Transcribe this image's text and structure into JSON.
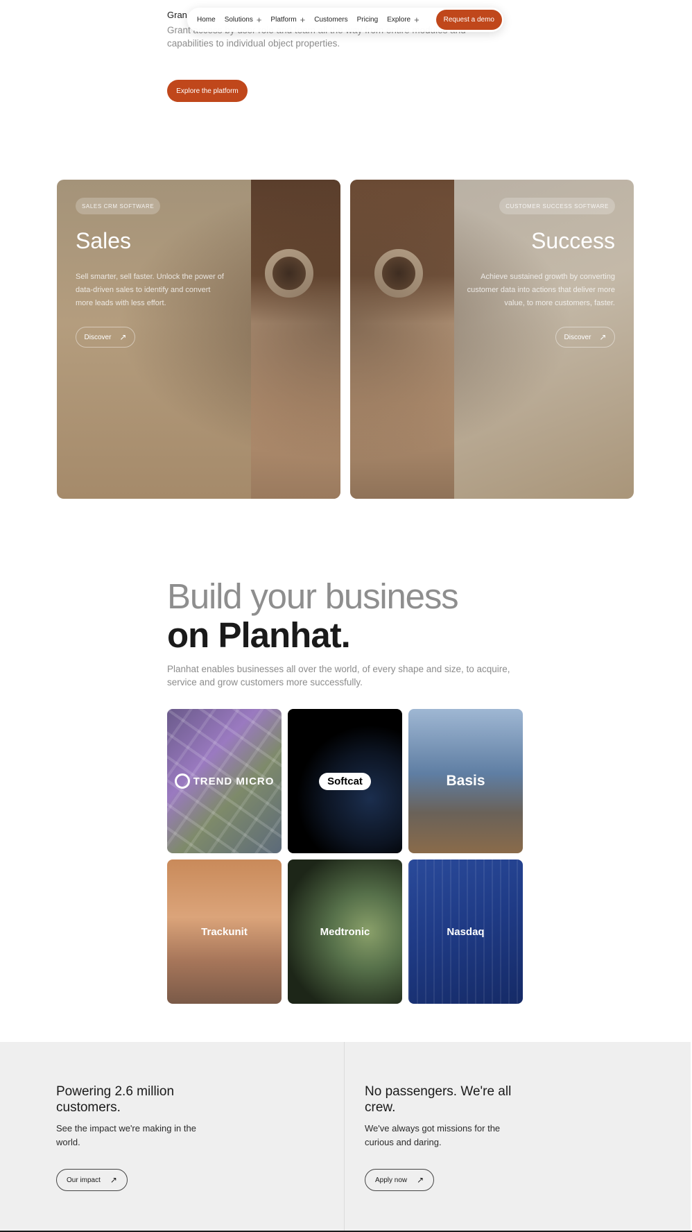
{
  "intro": {
    "heading": "Gran",
    "description": "Grant access by user role and team all the way from entire modules and capabilities to individual object properties.",
    "cta_label": "Explore the platform"
  },
  "nav": {
    "items": [
      {
        "label": "Home",
        "has_plus": false
      },
      {
        "label": "Solutions",
        "has_plus": true
      },
      {
        "label": "Platform",
        "has_plus": true
      },
      {
        "label": "Customers",
        "has_plus": false
      },
      {
        "label": "Pricing",
        "has_plus": false
      },
      {
        "label": "Explore",
        "has_plus": true
      }
    ],
    "cta_label": "Request a demo",
    "plus_glyph": "+"
  },
  "cards": {
    "sales": {
      "badge": "SALES CRM SOFTWARE",
      "title": "Sales",
      "description": "Sell smarter, sell faster. Unlock the power of data-driven sales to identify and convert more leads with less effort.",
      "button_label": "Discover",
      "button_icon": "arrow-up-right-icon"
    },
    "success": {
      "badge": "CUSTOMER SUCCESS SOFTWARE",
      "title": "Success",
      "description": "Achieve sustained growth by converting customer data into actions that deliver more value, to more customers, faster.",
      "button_label": "Discover",
      "button_icon": "arrow-up-right-icon"
    }
  },
  "build": {
    "heading_line1": "Build your business",
    "heading_line2": "on Planhat.",
    "description": "Planhat enables businesses all over the world, of every shape and size, to acquire, service and grow customers more successfully.",
    "customers": [
      {
        "name": "TREND MICRO"
      },
      {
        "name": "Softcat"
      },
      {
        "name": "Basis"
      },
      {
        "name": "Trackunit"
      },
      {
        "name": "Medtronic"
      },
      {
        "name": "Nasdaq"
      }
    ]
  },
  "bottom": {
    "left": {
      "title": "Powering 2.6 million customers.",
      "description": "See the impact we're making in the world.",
      "button_label": "Our impact"
    },
    "right": {
      "title": "No passengers. We're all crew.",
      "description": "We've always got missions for the curious and daring.",
      "button_label": "Apply now"
    }
  },
  "colors": {
    "accent": "#c0471b",
    "bottom_bg": "#efefef"
  }
}
